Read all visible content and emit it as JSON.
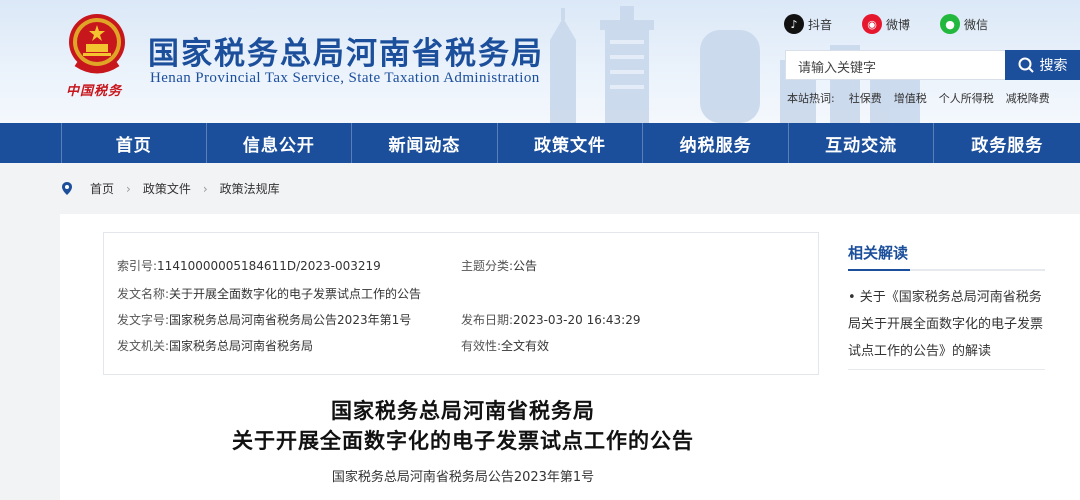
{
  "header": {
    "title": "国家税务总局河南省税务局",
    "subtitle": "Henan Provincial Tax Service, State Taxation Administration",
    "seal_text": "中国税务"
  },
  "social": {
    "douyin": "抖音",
    "weibo": "微博",
    "weixin": "微信"
  },
  "search": {
    "placeholder": "请输入关键字",
    "button": "搜索"
  },
  "hotwords": {
    "label": "本站热词:",
    "items": [
      "社保费",
      "增值税",
      "个人所得税",
      "减税降费"
    ]
  },
  "nav": {
    "items": [
      "首页",
      "信息公开",
      "新闻动态",
      "政策文件",
      "纳税服务",
      "互动交流",
      "政务服务"
    ]
  },
  "breadcrumb": {
    "items": [
      "首页",
      "政策文件",
      "政策法规库"
    ]
  },
  "meta": {
    "index_label": "索引号:",
    "index_value": "11410000005184611D/2023-003219",
    "topic_label": "主题分类:",
    "topic_value": "公告",
    "name_label": "发文名称:",
    "name_value": "关于开展全面数字化的电子发票试点工作的公告",
    "docno_label": "发文字号:",
    "docno_value": "国家税务总局河南省税务局公告2023年第1号",
    "date_label": "发布日期:",
    "date_value": "2023-03-20 16:43:29",
    "org_label": "发文机关:",
    "org_value": "国家税务总局河南省税务局",
    "validity_label": "有效性:",
    "validity_value": "全文有效"
  },
  "sidebar": {
    "title": "相关解读",
    "link": "• 关于《国家税务总局河南省税务局关于开展全面数字化的电子发票试点工作的公告》的解读"
  },
  "document": {
    "title_line1": "国家税务总局河南省税务局",
    "title_line2": "关于开展全面数字化的电子发票试点工作的公告",
    "number": "国家税务总局河南省税务局公告2023年第1号"
  },
  "colors": {
    "primary": "#1b4e9b",
    "seal_red": "#c8161d"
  }
}
